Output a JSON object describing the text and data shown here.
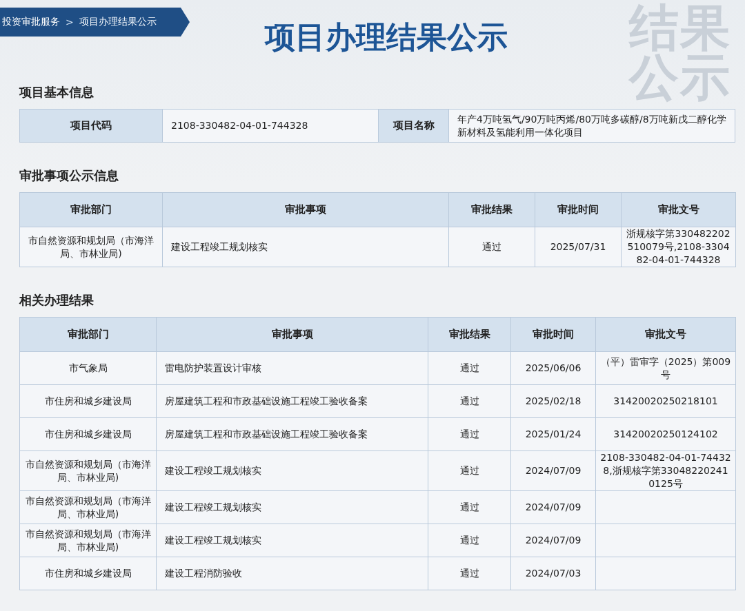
{
  "breadcrumb": [
    {
      "label": "投资审批服务",
      "kind": "link"
    },
    {
      "label": ">",
      "kind": "separator"
    },
    {
      "label": "项目办理结果公示",
      "kind": "current"
    }
  ],
  "title": "项目办理结果公示",
  "background_text": [
    "结果",
    "公示"
  ],
  "basic_info": {
    "heading": "项目基本信息",
    "fields": [
      {
        "label": "项目代码",
        "value": "2108-330482-04-01-744328"
      },
      {
        "label": "项目名称",
        "value": "年产4万吨氢气/90万吨丙烯/80万吨多碳醇/8万吨新戊二醇化学新材料及氢能利用一体化项目"
      }
    ]
  },
  "approval_info": {
    "heading": "审批事项公示信息",
    "columns": [
      "审批部门",
      "审批事项",
      "审批结果",
      "审批时间",
      "审批文号"
    ],
    "rows": [
      [
        "市自然资源和规划局（市海洋局、市林业局)",
        "建设工程竣工规划核实",
        "通过",
        "2025/07/31",
        "浙规核字第330482202510079号,2108-330482-04-01-744328"
      ]
    ]
  },
  "related_results": {
    "heading": "相关办理结果",
    "columns": [
      "审批部门",
      "审批事项",
      "审批结果",
      "审批时间",
      "审批文号"
    ],
    "rows": [
      [
        "市气象局",
        "雷电防护装置设计审核",
        "通过",
        "2025/06/06",
        "（平）雷审字（2025）第009号"
      ],
      [
        "市住房和城乡建设局",
        "房屋建筑工程和市政基础设施工程竣工验收备案",
        "通过",
        "2025/02/18",
        "31420020250218101"
      ],
      [
        "市住房和城乡建设局",
        "房屋建筑工程和市政基础设施工程竣工验收备案",
        "通过",
        "2025/01/24",
        "31420020250124102"
      ],
      [
        "市自然资源和规划局（市海洋局、市林业局)",
        "建设工程竣工规划核实",
        "通过",
        "2024/07/09",
        "2108-330482-04-01-744328,浙规核字第330482202410125号"
      ],
      [
        "市自然资源和规划局（市海洋局、市林业局)",
        "建设工程竣工规划核实",
        "通过",
        "2024/07/09",
        ""
      ],
      [
        "市自然资源和规划局（市海洋局、市林业局)",
        "建设工程竣工规划核实",
        "通过",
        "2024/07/09",
        ""
      ],
      [
        "市住房和城乡建设局",
        "建设工程消防验收",
        "通过",
        "2024/07/03",
        ""
      ]
    ]
  }
}
